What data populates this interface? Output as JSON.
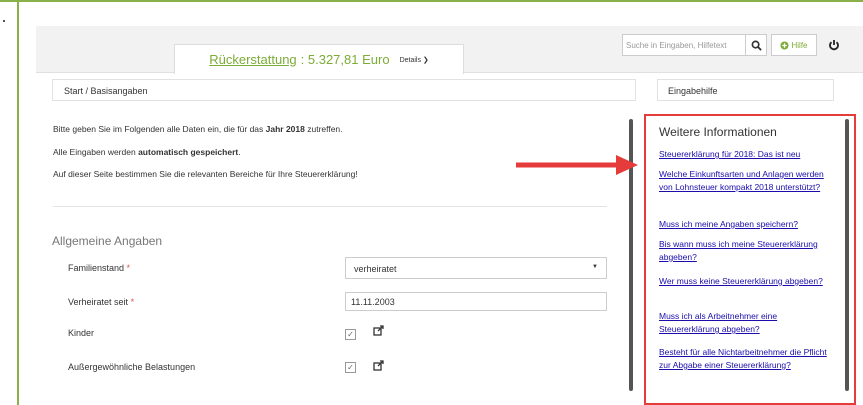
{
  "header": {
    "refund_label": "Rückerstattung",
    "refund_amount": ": 5.327,81 Euro",
    "details_label": "Details ❯",
    "search_placeholder": "Suche in Eingaben, Hilfetext",
    "help_label": "Hilfe"
  },
  "breadcrumb": "Start / Basisangaben",
  "help_header": "Eingabehilfe",
  "intro": {
    "line1_pre": "Bitte geben Sie im Folgenden alle Daten ein, die für das ",
    "line1_bold": "Jahr 2018",
    "line1_post": " zutreffen.",
    "line2_pre": "Alle Eingaben werden ",
    "line2_bold": "automatisch gespeichert",
    "line2_post": ".",
    "line3": "Auf dieser Seite bestimmen Sie die relevanten Bereiche für Ihre Steuererklärung!"
  },
  "form": {
    "section_title": "Allgemeine Angaben",
    "familienstand_label": "Familienstand",
    "familienstand_value": "verheiratet",
    "verheiratet_label": "Verheiratet seit",
    "verheiratet_value": "11.11.2003",
    "kinder_label": "Kinder",
    "belastungen_label": "Außergewöhnliche Belastungen",
    "required_mark": "*"
  },
  "info": {
    "title": "Weitere Informationen",
    "links": [
      "Steuererklärung für 2018: Das ist neu",
      "Welche Einkunftsarten und Anlagen werden von Lohnsteuer kompakt 2018 unterstützt?",
      "Muss ich meine Angaben speichern?",
      "Bis wann muss ich meine Steuererklärung abgeben?",
      "Wer muss keine Steuererklärung abgeben?",
      "Muss ich als Arbeitnehmer eine Steuererklärung abgeben?",
      "Besteht für alle Nichtarbeitnehmer die Pflicht zur Abgabe einer Steuererklärung?"
    ]
  },
  "colors": {
    "accent_green": "#7cab37",
    "highlight_red": "#e53b3b",
    "link_blue": "#1a0dab"
  }
}
